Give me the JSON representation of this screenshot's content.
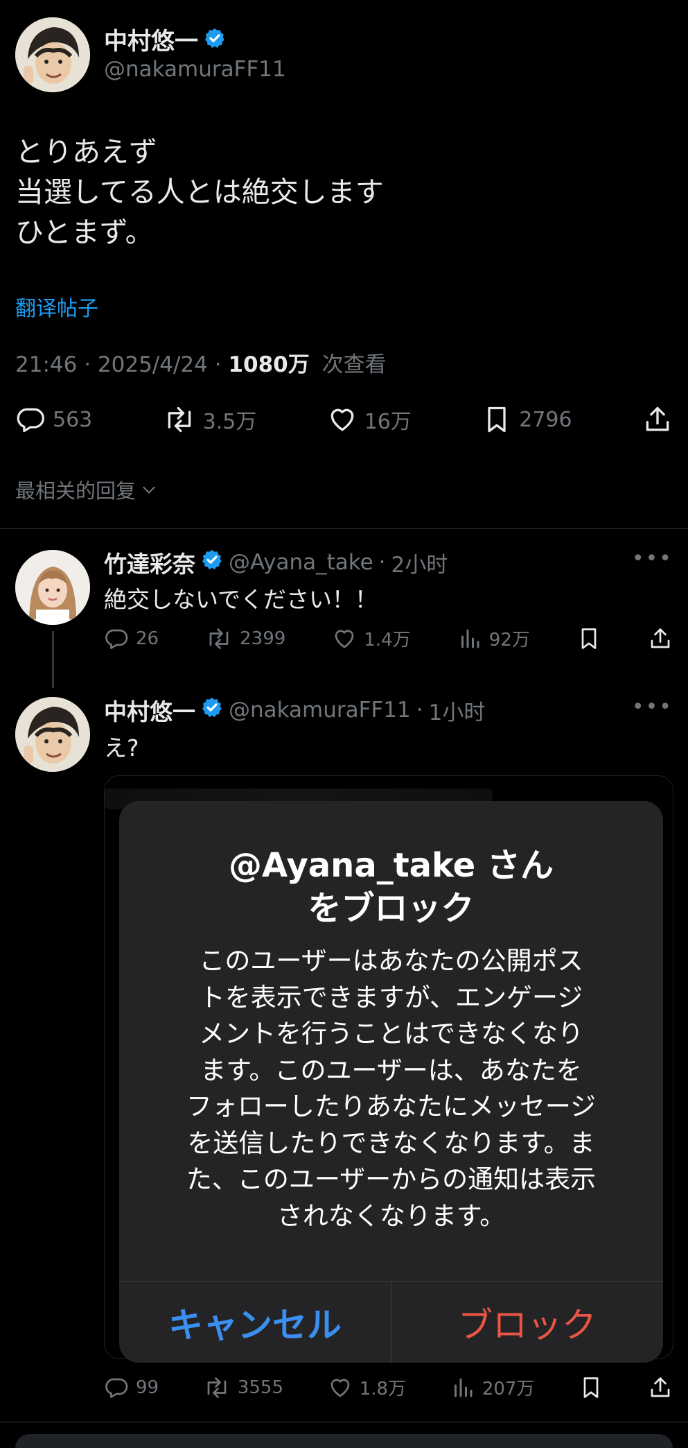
{
  "main_post": {
    "author_name": "中村悠一",
    "author_handle": "@nakamuraFF11",
    "body_lines": [
      "とりあえず",
      "当選してる人とは絶交します",
      "ひとまず。"
    ],
    "translate_label": "翻译帖子",
    "time": "21:46",
    "date": "2025/4/24",
    "views": "1080万",
    "views_label": "次查看",
    "stats": {
      "replies": "563",
      "reposts": "3.5万",
      "likes": "16万",
      "bookmarks": "2796"
    }
  },
  "sort_label": "最相关的回复",
  "replies": [
    {
      "author_name": "竹達彩奈",
      "author_handle": "@Ayana_take",
      "time": "2小时",
      "text": "絶交しないでください！！",
      "stats": {
        "replies": "26",
        "reposts": "2399",
        "likes": "1.4万",
        "views": "92万"
      }
    },
    {
      "author_name": "中村悠一",
      "author_handle": "@nakamuraFF11",
      "time": "1小时",
      "text": "え?",
      "stats": {
        "replies": "99",
        "reposts": "3555",
        "likes": "1.8万",
        "views": "207万"
      }
    }
  ],
  "dialog": {
    "title_lines": [
      "@Ayana_take さん",
      "をブロック"
    ],
    "message_lines": [
      "このユーザーはあなたの公開ポス",
      "トを表示できますが、エンゲージ",
      "メントを行うことはできなくなり",
      "ます。このユーザーは、あなたを",
      "フォローしたりあなたにメッセージ",
      "を送信したりできなくなります。ま",
      "た、このユーザーからの通知は表示",
      "されなくなります。"
    ],
    "cancel_label": "キャンセル",
    "block_label": "ブロック"
  },
  "more_label": "•••",
  "colors": {
    "accent": "#1d9bf0",
    "verified": "#1d9bf0",
    "destructive": "#eb5545",
    "dialog_bg": "#242426"
  },
  "icons": [
    "reply-icon",
    "repost-icon",
    "like-icon",
    "bookmark-icon",
    "share-icon",
    "views-icon",
    "verified-badge-icon",
    "chevron-down-icon",
    "more-icon"
  ]
}
